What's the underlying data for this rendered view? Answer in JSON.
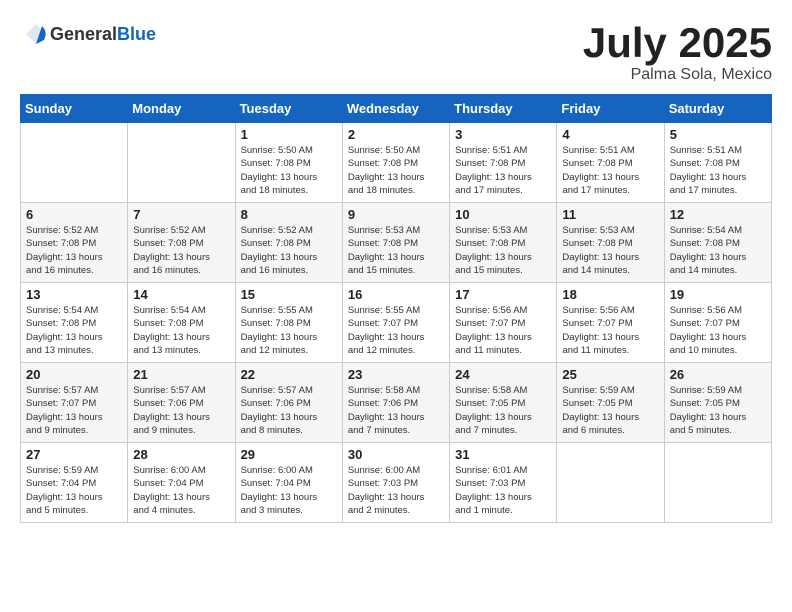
{
  "header": {
    "logo_general": "General",
    "logo_blue": "Blue",
    "title": "July 2025",
    "subtitle": "Palma Sola, Mexico"
  },
  "days_of_week": [
    "Sunday",
    "Monday",
    "Tuesday",
    "Wednesday",
    "Thursday",
    "Friday",
    "Saturday"
  ],
  "weeks": [
    [
      {
        "day": "",
        "info": ""
      },
      {
        "day": "",
        "info": ""
      },
      {
        "day": "1",
        "info": "Sunrise: 5:50 AM\nSunset: 7:08 PM\nDaylight: 13 hours\nand 18 minutes."
      },
      {
        "day": "2",
        "info": "Sunrise: 5:50 AM\nSunset: 7:08 PM\nDaylight: 13 hours\nand 18 minutes."
      },
      {
        "day": "3",
        "info": "Sunrise: 5:51 AM\nSunset: 7:08 PM\nDaylight: 13 hours\nand 17 minutes."
      },
      {
        "day": "4",
        "info": "Sunrise: 5:51 AM\nSunset: 7:08 PM\nDaylight: 13 hours\nand 17 minutes."
      },
      {
        "day": "5",
        "info": "Sunrise: 5:51 AM\nSunset: 7:08 PM\nDaylight: 13 hours\nand 17 minutes."
      }
    ],
    [
      {
        "day": "6",
        "info": "Sunrise: 5:52 AM\nSunset: 7:08 PM\nDaylight: 13 hours\nand 16 minutes."
      },
      {
        "day": "7",
        "info": "Sunrise: 5:52 AM\nSunset: 7:08 PM\nDaylight: 13 hours\nand 16 minutes."
      },
      {
        "day": "8",
        "info": "Sunrise: 5:52 AM\nSunset: 7:08 PM\nDaylight: 13 hours\nand 16 minutes."
      },
      {
        "day": "9",
        "info": "Sunrise: 5:53 AM\nSunset: 7:08 PM\nDaylight: 13 hours\nand 15 minutes."
      },
      {
        "day": "10",
        "info": "Sunrise: 5:53 AM\nSunset: 7:08 PM\nDaylight: 13 hours\nand 15 minutes."
      },
      {
        "day": "11",
        "info": "Sunrise: 5:53 AM\nSunset: 7:08 PM\nDaylight: 13 hours\nand 14 minutes."
      },
      {
        "day": "12",
        "info": "Sunrise: 5:54 AM\nSunset: 7:08 PM\nDaylight: 13 hours\nand 14 minutes."
      }
    ],
    [
      {
        "day": "13",
        "info": "Sunrise: 5:54 AM\nSunset: 7:08 PM\nDaylight: 13 hours\nand 13 minutes."
      },
      {
        "day": "14",
        "info": "Sunrise: 5:54 AM\nSunset: 7:08 PM\nDaylight: 13 hours\nand 13 minutes."
      },
      {
        "day": "15",
        "info": "Sunrise: 5:55 AM\nSunset: 7:08 PM\nDaylight: 13 hours\nand 12 minutes."
      },
      {
        "day": "16",
        "info": "Sunrise: 5:55 AM\nSunset: 7:07 PM\nDaylight: 13 hours\nand 12 minutes."
      },
      {
        "day": "17",
        "info": "Sunrise: 5:56 AM\nSunset: 7:07 PM\nDaylight: 13 hours\nand 11 minutes."
      },
      {
        "day": "18",
        "info": "Sunrise: 5:56 AM\nSunset: 7:07 PM\nDaylight: 13 hours\nand 11 minutes."
      },
      {
        "day": "19",
        "info": "Sunrise: 5:56 AM\nSunset: 7:07 PM\nDaylight: 13 hours\nand 10 minutes."
      }
    ],
    [
      {
        "day": "20",
        "info": "Sunrise: 5:57 AM\nSunset: 7:07 PM\nDaylight: 13 hours\nand 9 minutes."
      },
      {
        "day": "21",
        "info": "Sunrise: 5:57 AM\nSunset: 7:06 PM\nDaylight: 13 hours\nand 9 minutes."
      },
      {
        "day": "22",
        "info": "Sunrise: 5:57 AM\nSunset: 7:06 PM\nDaylight: 13 hours\nand 8 minutes."
      },
      {
        "day": "23",
        "info": "Sunrise: 5:58 AM\nSunset: 7:06 PM\nDaylight: 13 hours\nand 7 minutes."
      },
      {
        "day": "24",
        "info": "Sunrise: 5:58 AM\nSunset: 7:05 PM\nDaylight: 13 hours\nand 7 minutes."
      },
      {
        "day": "25",
        "info": "Sunrise: 5:59 AM\nSunset: 7:05 PM\nDaylight: 13 hours\nand 6 minutes."
      },
      {
        "day": "26",
        "info": "Sunrise: 5:59 AM\nSunset: 7:05 PM\nDaylight: 13 hours\nand 5 minutes."
      }
    ],
    [
      {
        "day": "27",
        "info": "Sunrise: 5:59 AM\nSunset: 7:04 PM\nDaylight: 13 hours\nand 5 minutes."
      },
      {
        "day": "28",
        "info": "Sunrise: 6:00 AM\nSunset: 7:04 PM\nDaylight: 13 hours\nand 4 minutes."
      },
      {
        "day": "29",
        "info": "Sunrise: 6:00 AM\nSunset: 7:04 PM\nDaylight: 13 hours\nand 3 minutes."
      },
      {
        "day": "30",
        "info": "Sunrise: 6:00 AM\nSunset: 7:03 PM\nDaylight: 13 hours\nand 2 minutes."
      },
      {
        "day": "31",
        "info": "Sunrise: 6:01 AM\nSunset: 7:03 PM\nDaylight: 13 hours\nand 1 minute."
      },
      {
        "day": "",
        "info": ""
      },
      {
        "day": "",
        "info": ""
      }
    ]
  ]
}
